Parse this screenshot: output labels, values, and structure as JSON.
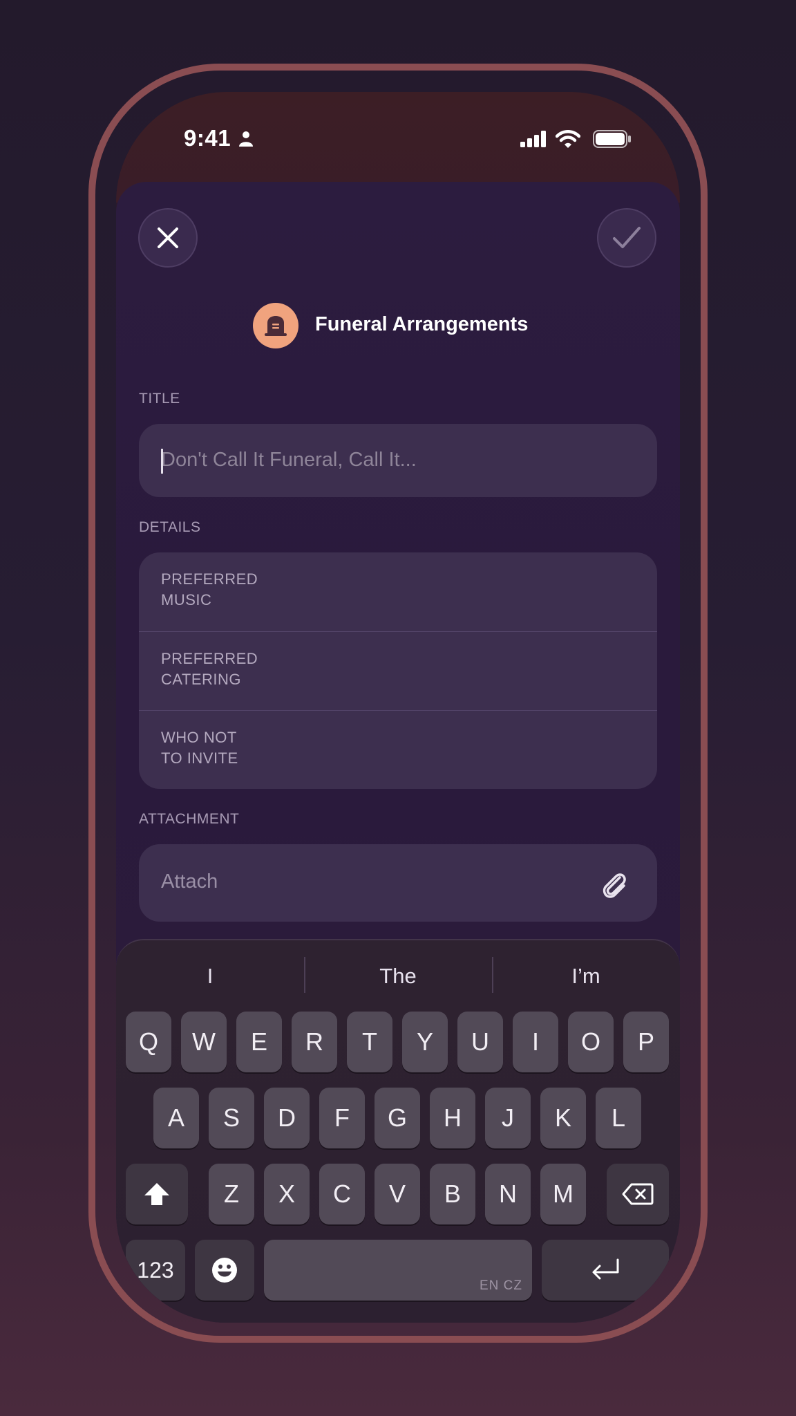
{
  "status_bar": {
    "time": "9:41"
  },
  "header": {
    "title": "Funeral Arrangements",
    "icon": "tombstone-icon"
  },
  "form": {
    "title_section": {
      "label": "TITLE",
      "placeholder": "Don't Call It Funeral, Call It..."
    },
    "details_section": {
      "label": "DETAILS",
      "rows": [
        {
          "line1": "PREFERRED",
          "line2": "MUSIC"
        },
        {
          "line1": "PREFERRED",
          "line2": "CATERING"
        },
        {
          "line1": "WHO NOT",
          "line2": "TO INVITE"
        }
      ]
    },
    "attachment_section": {
      "label": "ATTACHMENT",
      "placeholder": "Attach"
    }
  },
  "keyboard": {
    "suggestions": [
      "I",
      "The",
      "I’m"
    ],
    "row1": [
      "Q",
      "W",
      "E",
      "R",
      "T",
      "Y",
      "U",
      "I",
      "O",
      "P"
    ],
    "row2": [
      "A",
      "S",
      "D",
      "F",
      "G",
      "H",
      "J",
      "K",
      "L"
    ],
    "row3": [
      "Z",
      "X",
      "C",
      "V",
      "B",
      "N",
      "M"
    ],
    "numbers_key": "123",
    "space_languages": "EN CZ"
  },
  "colors": {
    "accent_icon": "#f0a37e",
    "frame": "#8a4d52",
    "sheet": "#2c1c3f"
  }
}
